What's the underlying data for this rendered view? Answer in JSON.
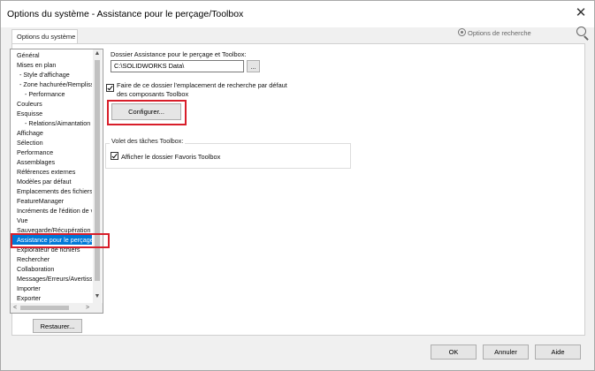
{
  "window": {
    "title": "Options du système - Assistance pour le perçage/Toolbox",
    "close_glyph": "✕"
  },
  "tabs": [
    {
      "label": "Options du système"
    }
  ],
  "search": {
    "placeholder": "Options de recherche"
  },
  "sidebar": {
    "items": [
      {
        "label": "Général",
        "level": 0
      },
      {
        "label": "Mises en plan",
        "level": 0
      },
      {
        "label": "- Style d'affichage",
        "level": 1
      },
      {
        "label": "- Zone hachurée/Remplissage",
        "level": 1
      },
      {
        "label": "- Performance",
        "level": 2
      },
      {
        "label": "Couleurs",
        "level": 0
      },
      {
        "label": "Esquisse",
        "level": 0
      },
      {
        "label": "- Relations/Aimantation",
        "level": 2
      },
      {
        "label": "Affichage",
        "level": 0
      },
      {
        "label": "Sélection",
        "level": 0
      },
      {
        "label": "Performance",
        "level": 0
      },
      {
        "label": "Assemblages",
        "level": 0
      },
      {
        "label": "Références externes",
        "level": 0
      },
      {
        "label": "Modèles par défaut",
        "level": 0
      },
      {
        "label": "Emplacements des fichiers",
        "level": 0
      },
      {
        "label": "FeatureManager",
        "level": 0
      },
      {
        "label": "Incréments de l'édition de valeurs",
        "level": 0
      },
      {
        "label": "Vue",
        "level": 0
      },
      {
        "label": "Sauvegarde/Récupération",
        "level": 0
      },
      {
        "label": "Assistance pour le perçage/Toolbox",
        "level": 0,
        "selected": true
      },
      {
        "label": "Explorateur de fichiers",
        "level": 0
      },
      {
        "label": "Rechercher",
        "level": 0
      },
      {
        "label": "Collaboration",
        "level": 0
      },
      {
        "label": "Messages/Erreurs/Avertissements",
        "level": 0
      },
      {
        "label": "Importer",
        "level": 0
      },
      {
        "label": "Exporter",
        "level": 0
      }
    ],
    "scroll_up": "▲",
    "scroll_down": "▼",
    "scroll_left": "<",
    "scroll_right": ">",
    "restore_label": "Restaurer..."
  },
  "main": {
    "folder_label": "Dossier Assistance pour le perçage et Toolbox:",
    "folder_value": "C:\\SOLIDWORKS Data\\",
    "browse_label": "...",
    "default_search_checkbox": {
      "checked": true,
      "line1": "Faire de ce dossier l'emplacement de recherche par défaut",
      "line2": "des composants Toolbox"
    },
    "configure_label": "Configurer...",
    "taskpane_group_title": "Volet des tâches Toolbox:",
    "favorites_checkbox": {
      "checked": true,
      "label": "Afficher le dossier Favoris Toolbox"
    }
  },
  "footer": {
    "ok_label": "OK",
    "cancel_label": "Annuler",
    "help_label": "Aide"
  },
  "colors": {
    "selection": "#0078d7",
    "highlight_frame": "#d81e2a"
  }
}
